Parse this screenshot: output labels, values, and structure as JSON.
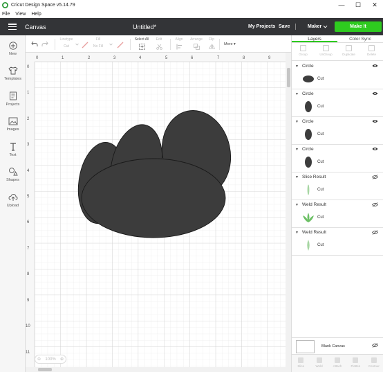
{
  "window": {
    "title": "Cricut Design Space  v5.14.79",
    "controls": [
      "—",
      "☐",
      "✕"
    ]
  },
  "menu": [
    "File",
    "View",
    "Help"
  ],
  "header": {
    "section": "Canvas",
    "document_title": "Untitled*",
    "my_projects": "My Projects",
    "save": "Save",
    "divider": "|",
    "machine": "Maker",
    "make_it": "Make It",
    "accent": "#2ecb1f"
  },
  "left_rail": [
    {
      "label": "New",
      "icon": "plus-icon"
    },
    {
      "label": "Templates",
      "icon": "shirt-icon"
    },
    {
      "label": "Projects",
      "icon": "projects-icon"
    },
    {
      "label": "Images",
      "icon": "image-icon"
    },
    {
      "label": "Text",
      "icon": "text-icon"
    },
    {
      "label": "Shapes",
      "icon": "shapes-icon"
    },
    {
      "label": "Upload",
      "icon": "upload-icon"
    }
  ],
  "toolbar": {
    "linetype_label": "Linetype",
    "linetype_value": "Cut",
    "fill_label": "Fill",
    "fill_value": "No Fill",
    "select_all": "Select All",
    "edit": "Edit",
    "align": "Align",
    "arrange": "Arrange",
    "flip": "Flip",
    "more": "More ▾"
  },
  "ruler": {
    "top": [
      "0",
      "1",
      "2",
      "3",
      "4",
      "5",
      "6",
      "7",
      "8",
      "9"
    ],
    "left": [
      "0",
      "1",
      "2",
      "3",
      "4",
      "5",
      "6",
      "7",
      "8",
      "9",
      "10",
      "11"
    ]
  },
  "zoom": {
    "minus": "⊖",
    "value": "100%",
    "plus": "⊕"
  },
  "panel": {
    "tabs": [
      "Layers",
      "Color Sync"
    ],
    "actions": [
      "Group",
      "UnGroup",
      "Duplicate",
      "Delete"
    ],
    "layers": [
      {
        "name": "Circle",
        "op": "Cut",
        "thumb": "ellipse-wide",
        "color": "#3d3d3d"
      },
      {
        "name": "Circle",
        "op": "Cut",
        "thumb": "ellipse-tall",
        "color": "#3d3d3d"
      },
      {
        "name": "Circle",
        "op": "Cut",
        "thumb": "ellipse-tall",
        "color": "#3d3d3d"
      },
      {
        "name": "Circle",
        "op": "Cut",
        "thumb": "ellipse-tall",
        "color": "#3d3d3d"
      },
      {
        "name": "Slice Result",
        "op": "Cut",
        "thumb": "thin-leaf",
        "color": "#a7d6a3"
      },
      {
        "name": "Weld Result",
        "op": "Cut",
        "thumb": "flower",
        "color": "#6cc065"
      },
      {
        "name": "Weld Result",
        "op": "Cut",
        "thumb": "leaf",
        "color": "#a7d6a3"
      }
    ],
    "blank_canvas": "Blank Canvas",
    "bottom_actions": [
      "Slice",
      "Weld",
      "Attach",
      "Flatten",
      "Contour"
    ]
  },
  "canvas": {
    "shape_fill": "#3c3c3c",
    "grid_color": "#e3e3e3",
    "grid_major_color": "#cfcfcf"
  }
}
